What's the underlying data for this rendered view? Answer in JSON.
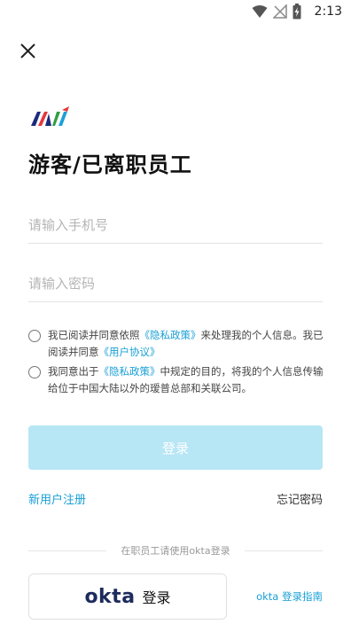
{
  "status_bar": {
    "time": "2:13",
    "icons": [
      "wifi-icon",
      "no-signal-icon",
      "battery-charging-icon"
    ]
  },
  "title": "游客/已离职员工",
  "phone_field": {
    "placeholder": "请输入手机号",
    "value": ""
  },
  "password_field": {
    "placeholder": "请输入密码",
    "value": ""
  },
  "consent_1": {
    "text_a": "我已阅读并同意依照",
    "privacy_link": "《隐私政策》",
    "text_b": "来处理我的个人信息。我已阅读并同意",
    "user_link": "《用户协议》"
  },
  "consent_2": {
    "text_a": "我同意出于",
    "privacy_link": "《隐私政策》",
    "text_b": "中规定的目的，将我的个人信息传输给位于中国大陆以外的瑷普总部和关联公司。"
  },
  "login_button": "登录",
  "register_link": "新用户注册",
  "forgot_link": "忘记密码",
  "divider_text": "在职员工请使用okta登录",
  "okta_button": {
    "brand": "okta",
    "label": "登录"
  },
  "okta_guide": "okta 登录指南",
  "colors": {
    "accent": "#1aa0d6",
    "button_disabled": "#b7e6f5"
  }
}
